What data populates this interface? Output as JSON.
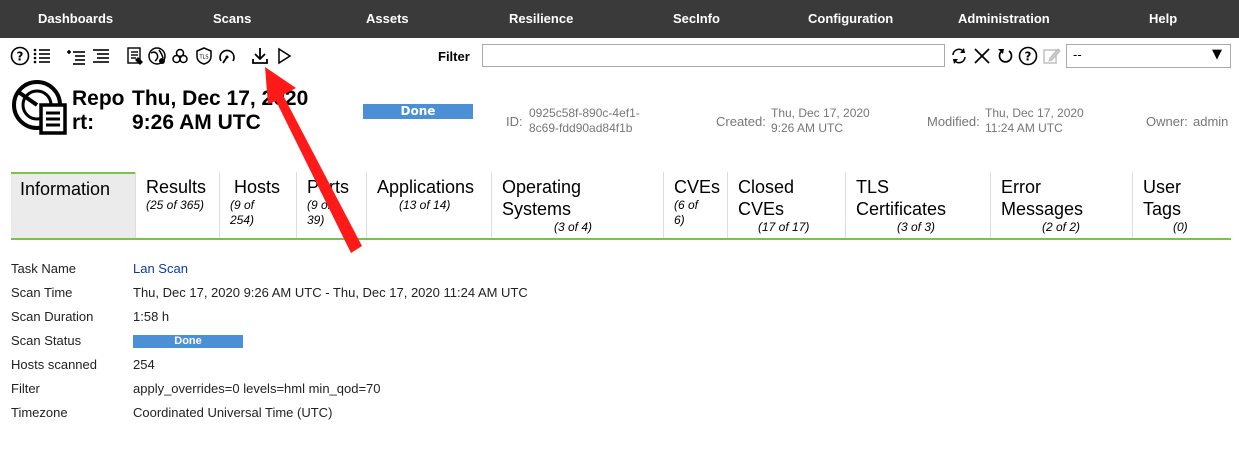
{
  "nav": {
    "items": [
      "Dashboards",
      "Scans",
      "Assets",
      "Resilience",
      "SecInfo",
      "Configuration",
      "Administration",
      "Help"
    ]
  },
  "toolbar": {
    "icons": [
      "help-icon",
      "list-icon",
      "list-indent-icon",
      "report-format-icon",
      "network-icon",
      "biohazard-icon",
      "tls-shield-icon",
      "dash-gauge-icon",
      "download-icon",
      "play-icon"
    ],
    "filter_label": "Filter",
    "filter_value": "",
    "filter_actions": [
      "refresh-icon",
      "clear-icon",
      "reset-icon",
      "help-icon",
      "edit-icon"
    ],
    "filter_select_value": "--"
  },
  "header": {
    "title": "Report:",
    "date": "Thu, Dec 17, 2020 9:26 AM UTC",
    "status": "Done",
    "id_label": "ID:",
    "id_value": "0925c58f-890c-4ef1-8c69-fdd90ad84f1b",
    "created_label": "Created:",
    "created_value": "Thu, Dec 17, 2020 9:26 AM UTC",
    "modified_label": "Modified:",
    "modified_value": "Thu, Dec 17, 2020 11:24 AM UTC",
    "owner_label": "Owner:",
    "owner_value": "admin"
  },
  "tabs": [
    {
      "name": "Information",
      "count": ""
    },
    {
      "name": "Results",
      "count": "(25 of 365)"
    },
    {
      "name": "Hosts",
      "count": "(9 of 254)"
    },
    {
      "name": "Ports",
      "count": "(9 of 39)"
    },
    {
      "name": "Applications",
      "count": "(13 of 14)"
    },
    {
      "name": "Operating Systems",
      "count": "(3 of 4)"
    },
    {
      "name": "CVEs",
      "count": "(6 of 6)"
    },
    {
      "name": "Closed CVEs",
      "count": "(17 of 17)"
    },
    {
      "name": "TLS Certificates",
      "count": "(3 of 3)"
    },
    {
      "name": "Error Messages",
      "count": "(2 of 2)"
    },
    {
      "name": "User Tags",
      "count": "(0)"
    }
  ],
  "info": {
    "task_name_label": "Task Name",
    "task_name_value": "Lan Scan",
    "scan_time_label": "Scan Time",
    "scan_time_value": "Thu, Dec 17, 2020 9:26 AM UTC - Thu, Dec 17, 2020 11:24 AM UTC",
    "scan_duration_label": "Scan Duration",
    "scan_duration_value": "1:58 h",
    "scan_status_label": "Scan Status",
    "scan_status_value": "Done",
    "hosts_scanned_label": "Hosts scanned",
    "hosts_scanned_value": "254",
    "filter_label": "Filter",
    "filter_value": "apply_overrides=0 levels=hml min_qod=70",
    "timezone_label": "Timezone",
    "timezone_value": "Coordinated Universal Time (UTC)"
  },
  "colors": {
    "nav_bg": "#3a3a3a",
    "accent_green": "#7cc04e",
    "status_blue": "#4b8fd6",
    "link_blue": "#0a3aa8",
    "annotation_red": "#ff1a1a"
  }
}
